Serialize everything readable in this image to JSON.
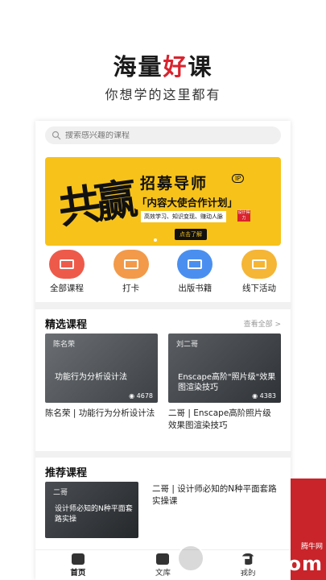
{
  "hero": {
    "title_pre": "海量",
    "title_accent": "好",
    "title_post": "课",
    "subtitle": "你想学的这里都有"
  },
  "search": {
    "placeholder": "搜索感兴趣的课程"
  },
  "banner": {
    "calligraphy": "共赢",
    "title": "招募导师",
    "ip_tag": "IP",
    "bracket_text": "「内容大使合作计划」",
    "strip_text": "高效学习、知识变现、赚动人脉",
    "badge_text": "设计得力",
    "button": "点击了解"
  },
  "quick": [
    {
      "label": "全部课程",
      "color": "#ee5a4a",
      "icon": "monitor-icon"
    },
    {
      "label": "打卡",
      "color": "#f29a4a",
      "icon": "calendar-icon"
    },
    {
      "label": "出版书籍",
      "color": "#4a8ff0",
      "icon": "book-icon"
    },
    {
      "label": "线下活动",
      "color": "#f5b535",
      "icon": "ticket-icon"
    }
  ],
  "featured": {
    "title": "精选课程",
    "more": "查看全部 >",
    "cards": [
      {
        "tag": "陈名荣",
        "overlay": "功能行为分析设计法",
        "views": "4678",
        "title": "陈名荣 | 功能行为分析设计法"
      },
      {
        "tag": "刘二哥",
        "overlay": "Enscape高阶\"照片级\"效果图渲染技巧",
        "views": "4383",
        "title": "二哥 | Enscape高阶照片级 效果图渲染技巧"
      }
    ]
  },
  "recommend": {
    "title": "推荐课程",
    "item": {
      "tag": "二哥",
      "overlay": "设计师必知的N种平面套路实操",
      "title": "二哥 | 设计师必知的N种平面套路实操课"
    }
  },
  "tabs": [
    {
      "label": "首页",
      "icon": "home-icon"
    },
    {
      "label": "文库",
      "icon": "library-icon"
    },
    {
      "label": "我的",
      "icon": "profile-icon"
    }
  ],
  "watermark": {
    "text": "QQTN.com",
    "sub": "腾牛网"
  },
  "colors": {
    "accent": "#d9232d",
    "banner": "#f7c21a"
  }
}
